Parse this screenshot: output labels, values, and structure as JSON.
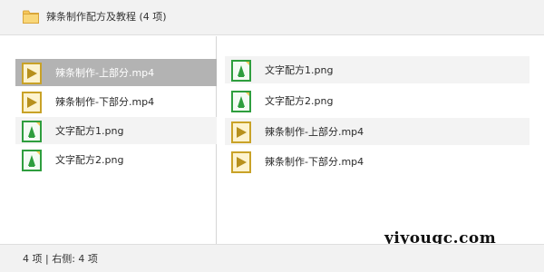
{
  "window": {
    "title": "辣条制作配方及教程 (4 项)",
    "folder_icon": "folder-icon"
  },
  "left_pane": {
    "items": [
      {
        "label": "辣条制作-上部分.mp4",
        "icon": "video-file-icon",
        "selected": true
      },
      {
        "label": "辣条制作-下部分.mp4",
        "icon": "video-file-icon",
        "selected": false
      },
      {
        "label": "文字配方1.png",
        "icon": "image-file-icon",
        "selected": false
      },
      {
        "label": "文字配方2.png",
        "icon": "image-file-icon",
        "selected": false
      }
    ]
  },
  "right_pane": {
    "items": [
      {
        "label": "文字配方1.png",
        "icon": "image-file-icon"
      },
      {
        "label": "文字配方2.png",
        "icon": "image-file-icon"
      },
      {
        "label": "辣条制作-上部分.mp4",
        "icon": "video-file-icon"
      },
      {
        "label": "辣条制作-下部分.mp4",
        "icon": "video-file-icon"
      }
    ]
  },
  "status": {
    "text": "4 项 | 右侧: 4 项"
  },
  "watermark": "yiyouqc.com",
  "colors": {
    "selected_row": "#b3b3b3",
    "alt_row": "#f3f3f3",
    "bars": "#f2f2f2",
    "folder": "#f6c75a",
    "video_icon": "#c9a227",
    "image_icon": "#2e9e3e"
  }
}
